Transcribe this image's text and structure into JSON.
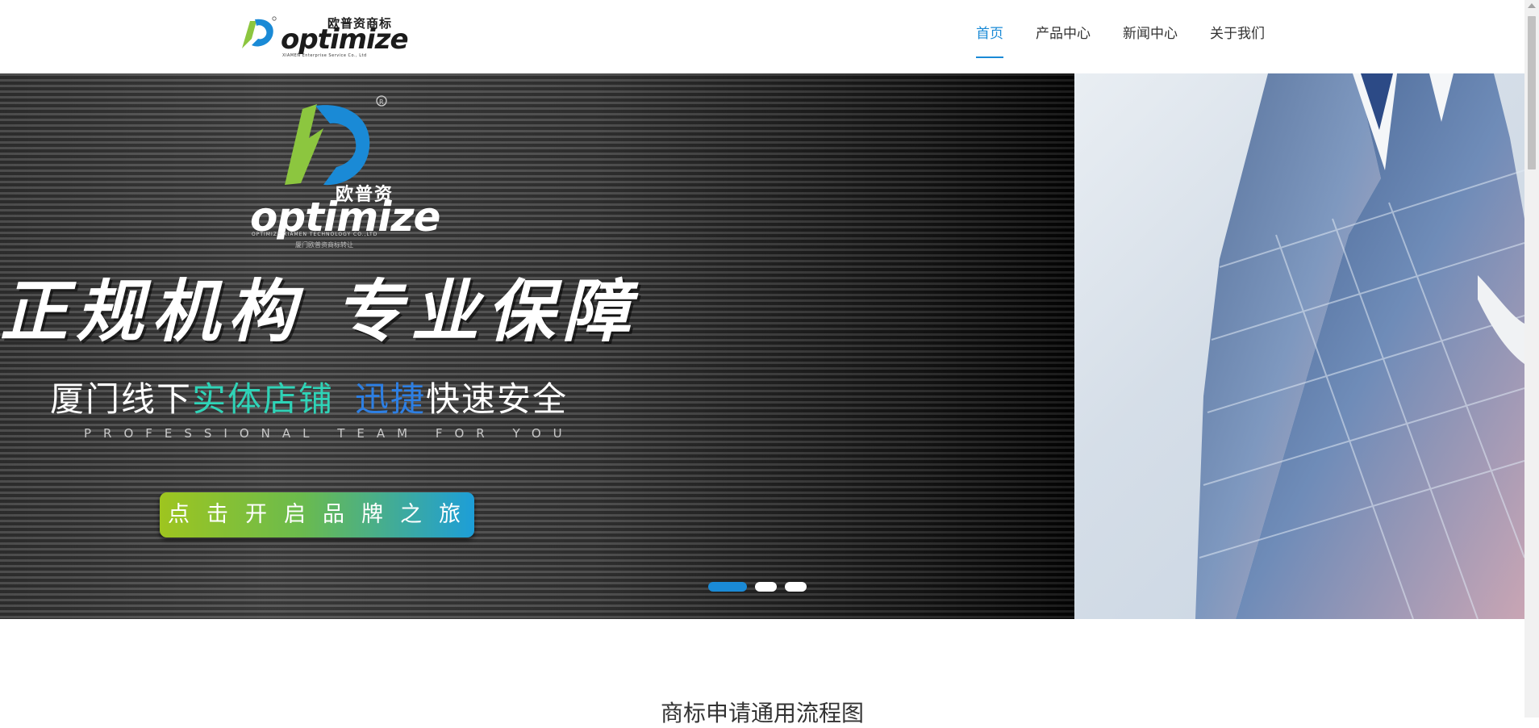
{
  "header": {
    "logo": {
      "cn": "欧普资商标",
      "en": "optimize",
      "sub": "XIAMEN Enterprise Service Co., Ltd"
    },
    "nav": [
      {
        "label": "首页",
        "active": true
      },
      {
        "label": "产品中心",
        "active": false
      },
      {
        "label": "新闻中心",
        "active": false
      },
      {
        "label": "关于我们",
        "active": false
      }
    ]
  },
  "banner": {
    "brand_cn": "欧普资",
    "brand_en": "optimize",
    "brand_sub": "OPTIMIZE XIAMEN TECHNOLOGY CO.,LTD",
    "brand_sub2": "厦门欧普资商标转让",
    "headline": "正规机构 专业保障",
    "subline": {
      "part1": "厦门线下",
      "part2": "实体店铺",
      "part3": "迅捷",
      "part4": "快速安全"
    },
    "tagline": "PROFESSIONAL TEAM FOR YOU",
    "cta": "点击开启品牌之旅",
    "slides": 3,
    "active_slide": 1,
    "colors": {
      "accent": "#1a8ad6",
      "teal": "#2fd3b7",
      "blue": "#2d7fe3",
      "green": "#9ec51f"
    }
  },
  "section": {
    "title": "商标申请通用流程图"
  }
}
